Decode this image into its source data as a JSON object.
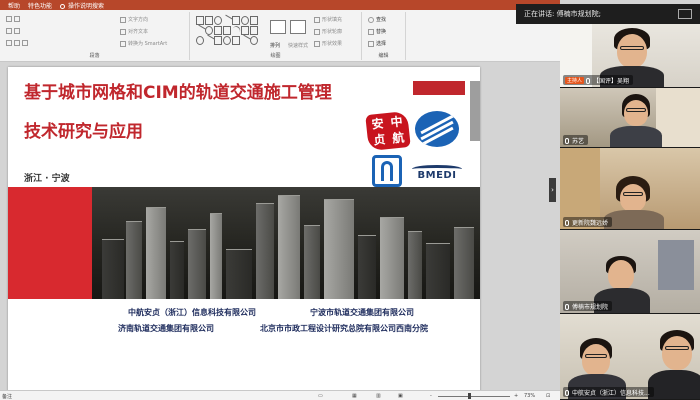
{
  "ribbon": {
    "tabs": [
      "帮助",
      "特色功能",
      "操作说明搜索"
    ],
    "group_paragraph": "段落",
    "group_drawing": "绘图",
    "group_edit": "编辑",
    "items": {
      "text_direction": "文字方向",
      "align_text": "对齐文本",
      "convert_smartart": "转换为 SmartArt",
      "arrange": "排列",
      "quick_styles": "快速样式",
      "shape_fill": "形状填充",
      "shape_outline": "形状轮廓",
      "shape_effects": "形状效果",
      "find": "查找",
      "replace": "替换",
      "select": "选择"
    }
  },
  "slide": {
    "title_line1": "基于城市网格和CIM的轨道交通施工管理",
    "title_line2": "技术研究与应用",
    "location": "浙江 · 宁波",
    "seal_chars": [
      "安",
      "中",
      "贞",
      "航"
    ],
    "logo_bmedi": "BMEDI",
    "companies": [
      "中航安贞（浙江）信息科技有限公司",
      "宁波市轨道交通集团有限公司",
      "济南轨道交通集团有限公司",
      "北京市市政工程设计研究总院有限公司西南分院"
    ]
  },
  "statusbar": {
    "notes": "备注",
    "zoom": "73%",
    "zoom_minus": "-",
    "zoom_plus": "+"
  },
  "meeting": {
    "speaking_banner": "正在讲话: 傅楠市规划院;",
    "host_badge": "主持人",
    "participants": [
      {
        "name": "【国评】吴翔"
      },
      {
        "name": "苏艺"
      },
      {
        "name": "更新院魏远娇"
      },
      {
        "name": "傅楠市规划院"
      },
      {
        "name": "中航安贞（浙江）信息科技..."
      }
    ]
  },
  "colors": {
    "ribbon_accent": "#b7472a",
    "title_red": "#c0272d",
    "company_blue": "#1d2b5c",
    "host_orange": "#e5561e"
  }
}
